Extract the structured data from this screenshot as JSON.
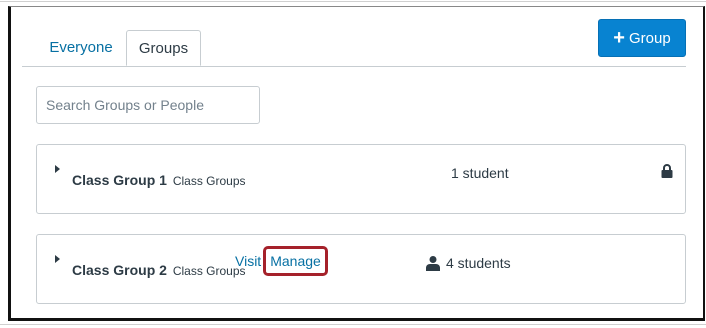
{
  "tabs": [
    {
      "label": "Everyone"
    },
    {
      "label": "Groups"
    }
  ],
  "add_group_button": {
    "icon": "plus-icon",
    "label": "Group"
  },
  "search": {
    "placeholder": "Search Groups or People",
    "value": ""
  },
  "groups": [
    {
      "name": "Class Group 1",
      "category": "Class Groups",
      "count": "1 student",
      "icon": "lock-icon"
    },
    {
      "name": "Class Group 2",
      "category": "Class Groups",
      "count": "4 students",
      "icon": "person-icon",
      "visit_label": "Visit",
      "manage_label": "Manage"
    }
  ],
  "colors": {
    "accent": "#0883d1",
    "link": "#0770a3",
    "highlight": "#a5212a",
    "text": "#2d3b45",
    "border": "#c7cdd1"
  }
}
